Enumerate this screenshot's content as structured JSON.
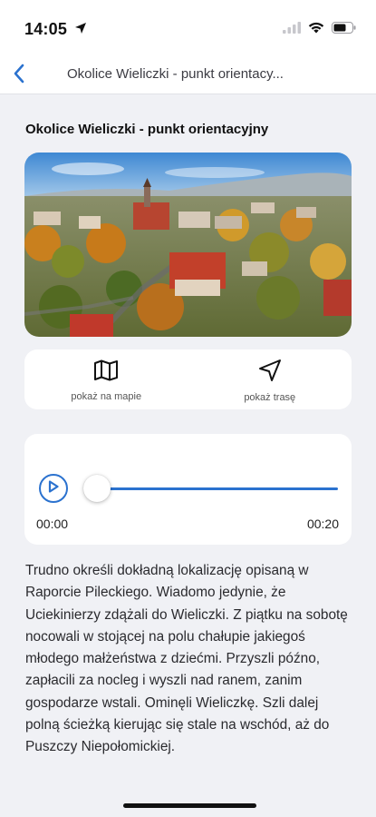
{
  "status_bar": {
    "time": "14:05",
    "icons": [
      "location-arrow-icon",
      "cellular-signal-icon",
      "wifi-icon",
      "battery-icon"
    ]
  },
  "nav": {
    "back_icon": "chevron-left-icon",
    "title": "Okolice Wieliczki - punkt orientacy..."
  },
  "page": {
    "title": "Okolice Wieliczki - punkt orientacyjny"
  },
  "actions": {
    "map": {
      "label": "pokaż na mapie",
      "icon": "map-icon"
    },
    "route": {
      "label": "pokaż trasę",
      "icon": "navigation-arrow-icon"
    }
  },
  "player": {
    "current_time": "00:00",
    "total_time": "00:20",
    "progress": 0,
    "play_icon": "play-circle-icon"
  },
  "description": "Trudno określi dokładną lokalizację opisaną w Raporcie Pileckiego. Wiadomo jedynie, że Uciekinierzy zdążali do Wieliczki. Z piątku na sobotę nocowali w stojącej na polu chałupie jakiegoś młodego małżeństwa z dziećmi. Przyszli późno, zapłacili za nocleg i wyszli nad ranem, zanim gospodarze wstali. Ominęli Wieliczkę. Szli dalej polną ścieżką kierując się stale na wschód, aż do Puszczy Niepołomickiej.",
  "colors": {
    "accent": "#2b72cf",
    "background": "#f0f1f5",
    "card": "#ffffff"
  }
}
